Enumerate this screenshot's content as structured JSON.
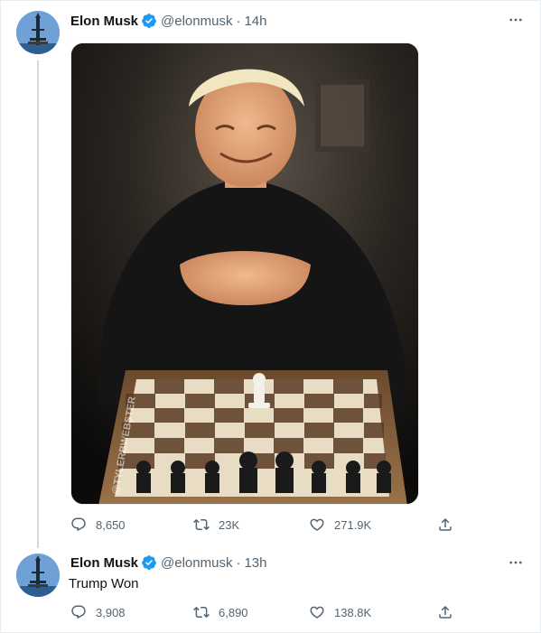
{
  "tweets": [
    {
      "author_name": "Elon Musk",
      "handle": "@elonmusk",
      "separator": "·",
      "time": "14h",
      "text": "",
      "media": {
        "watermark": "@TYLERBWEBSTER"
      },
      "stats": {
        "replies": "8,650",
        "retweets": "23K",
        "likes": "271.9K"
      }
    },
    {
      "author_name": "Elon Musk",
      "handle": "@elonmusk",
      "separator": "·",
      "time": "13h",
      "text": "Trump Won",
      "stats": {
        "replies": "3,908",
        "retweets": "6,890",
        "likes": "138.8K"
      }
    }
  ],
  "colors": {
    "verified": "#1d9bf0",
    "secondary_text": "#536471",
    "thread_line": "#cfd9de"
  },
  "icons": [
    "verified-badge-icon",
    "more-icon",
    "reply-icon",
    "retweet-icon",
    "like-icon",
    "share-icon"
  ]
}
